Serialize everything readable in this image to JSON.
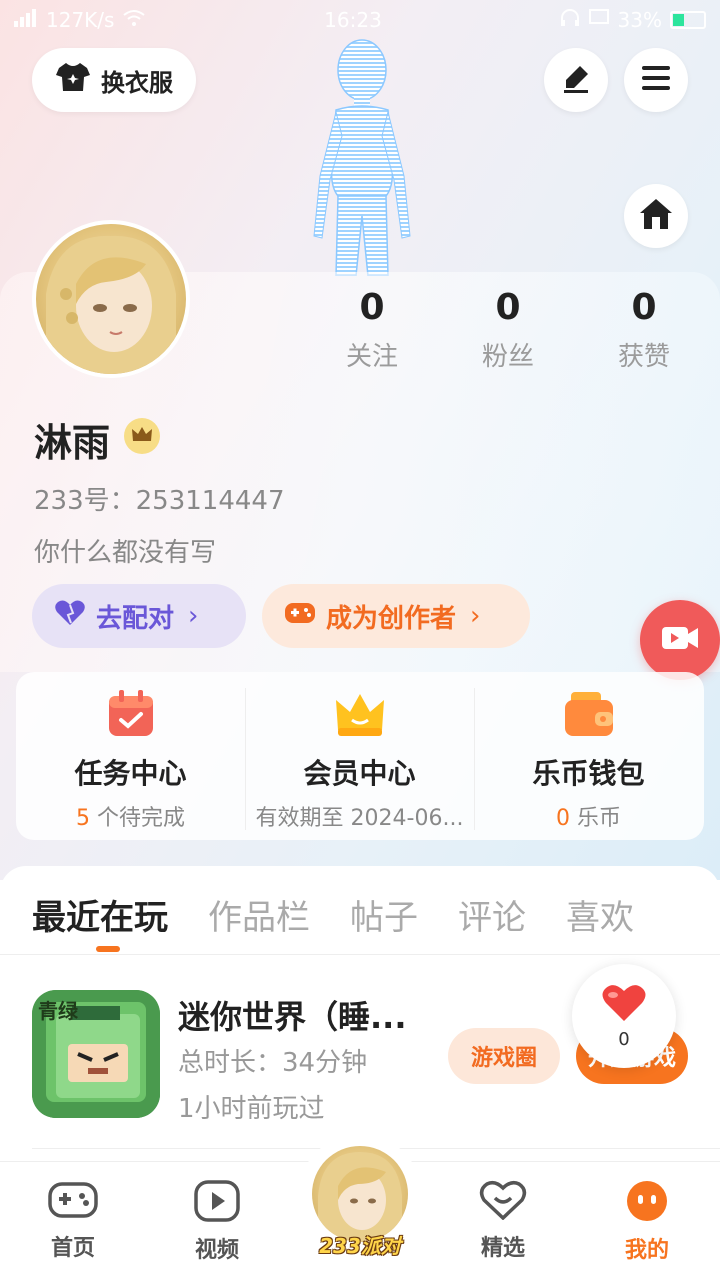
{
  "status_bar": {
    "network_speed": "127K/s",
    "time": "16:23",
    "battery": "33%",
    "battery_level": 0.33
  },
  "header": {
    "outfit_label": "换衣服",
    "icons": [
      "shirt-icon",
      "edit-icon",
      "menu-icon",
      "home-icon"
    ]
  },
  "profile": {
    "username": "淋雨",
    "uid": "233号：253114447",
    "bio": "你什么都没有写",
    "stats": [
      {
        "value": "0",
        "label": "关注"
      },
      {
        "value": "0",
        "label": "粉丝"
      },
      {
        "value": "0",
        "label": "获赞"
      }
    ],
    "match_label": "去配对",
    "creator_label": "成为创作者"
  },
  "features": [
    {
      "title": "任务中心",
      "count": "5",
      "sub": " 个待完成"
    },
    {
      "title": "会员中心",
      "sub": "有效期至 2024-06..."
    },
    {
      "title": "乐币钱包",
      "count": "0",
      "sub": " 乐币"
    }
  ],
  "tabs": [
    "最近在玩",
    "作品栏",
    "帖子",
    "评论",
    "喜欢"
  ],
  "recent_game": {
    "title": "迷你世界（睡...",
    "icon_text": "青绿",
    "duration": "总时长：34分钟",
    "last_played": "1小时前玩过",
    "circle_label": "游戏圈",
    "play_label": "开始游戏",
    "like_count": "0"
  },
  "bottom_nav": {
    "items": [
      "首页",
      "视频",
      "精选",
      "我的"
    ],
    "center_label": "233派对"
  },
  "colors": {
    "accent": "#f7741f",
    "purple": "#6a57d8",
    "video_fab": "#f05a5a"
  }
}
